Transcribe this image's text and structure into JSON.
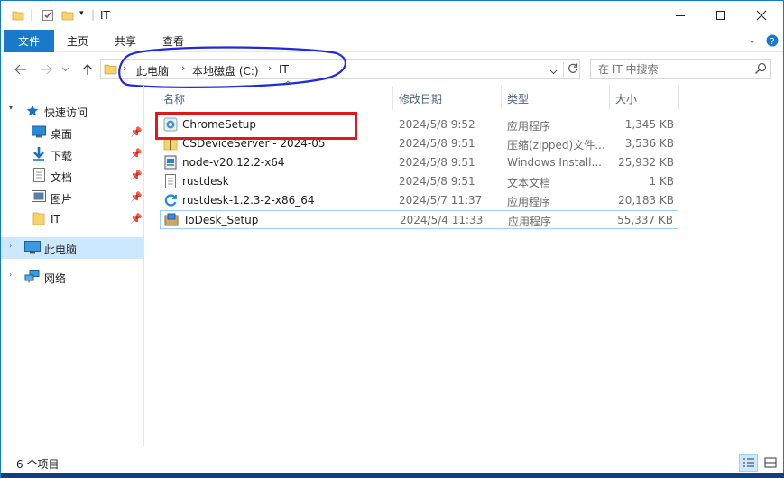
{
  "window": {
    "title": "IT",
    "quick_access_icons": [
      "folder-icon",
      "properties-check-icon",
      "new-folder-icon",
      "customize-dropdown-icon"
    ],
    "controls": [
      "minimize-icon",
      "maximize-icon",
      "close-icon"
    ]
  },
  "ribbon": {
    "tabs": [
      {
        "label": "文件"
      },
      {
        "label": "主页"
      },
      {
        "label": "共享"
      },
      {
        "label": "查看"
      }
    ],
    "right_icons": [
      "expand-ribbon-icon",
      "help-icon"
    ]
  },
  "address": {
    "crumbs": [
      "此电脑",
      "本地磁盘 (C:)",
      "IT"
    ],
    "separator": "›"
  },
  "search": {
    "placeholder": "在 IT 中搜索"
  },
  "sidebar": {
    "quick_access": "快速访问",
    "items": [
      {
        "label": "桌面",
        "icon": "desktop-icon",
        "pinned": true
      },
      {
        "label": "下载",
        "icon": "download-icon",
        "pinned": true
      },
      {
        "label": "文档",
        "icon": "document-icon",
        "pinned": true
      },
      {
        "label": "图片",
        "icon": "picture-icon",
        "pinned": true
      },
      {
        "label": "IT",
        "icon": "folder-icon",
        "pinned": true
      }
    ],
    "this_pc": "此电脑",
    "network": "网络"
  },
  "columns": {
    "name": "名称",
    "date": "修改日期",
    "type": "类型",
    "size": "大小"
  },
  "files": [
    {
      "name": "ChromeSetup",
      "date": "2024/5/8 9:52",
      "type": "应用程序",
      "size": "1,345 KB",
      "icon": "chrome-installer-icon"
    },
    {
      "name": "CSDeviceServer - 2024-05",
      "date": "2024/5/8 9:51",
      "type": "压缩(zipped)文件...",
      "size": "3,536 KB",
      "icon": "zip-folder-icon"
    },
    {
      "name": "node-v20.12.2-x64",
      "date": "2024/5/8 9:51",
      "type": "Windows Install...",
      "size": "25,932 KB",
      "icon": "msi-installer-icon"
    },
    {
      "name": "rustdesk",
      "date": "2024/5/8 9:51",
      "type": "文本文档",
      "size": "1 KB",
      "icon": "text-file-icon"
    },
    {
      "name": "rustdesk-1.2.3-2-x86_64",
      "date": "2024/5/7 11:37",
      "type": "应用程序",
      "size": "20,183 KB",
      "icon": "rustdesk-app-icon"
    },
    {
      "name": "ToDesk_Setup",
      "date": "2024/5/4 11:33",
      "type": "应用程序",
      "size": "55,337 KB",
      "icon": "todesk-installer-icon"
    }
  ],
  "status": {
    "count": "6 个项目"
  },
  "colors": {
    "accent": "#1979ca",
    "selection": "#cce8ff",
    "annotation_red": "#e0171d",
    "annotation_blue": "#1f2bdc"
  }
}
